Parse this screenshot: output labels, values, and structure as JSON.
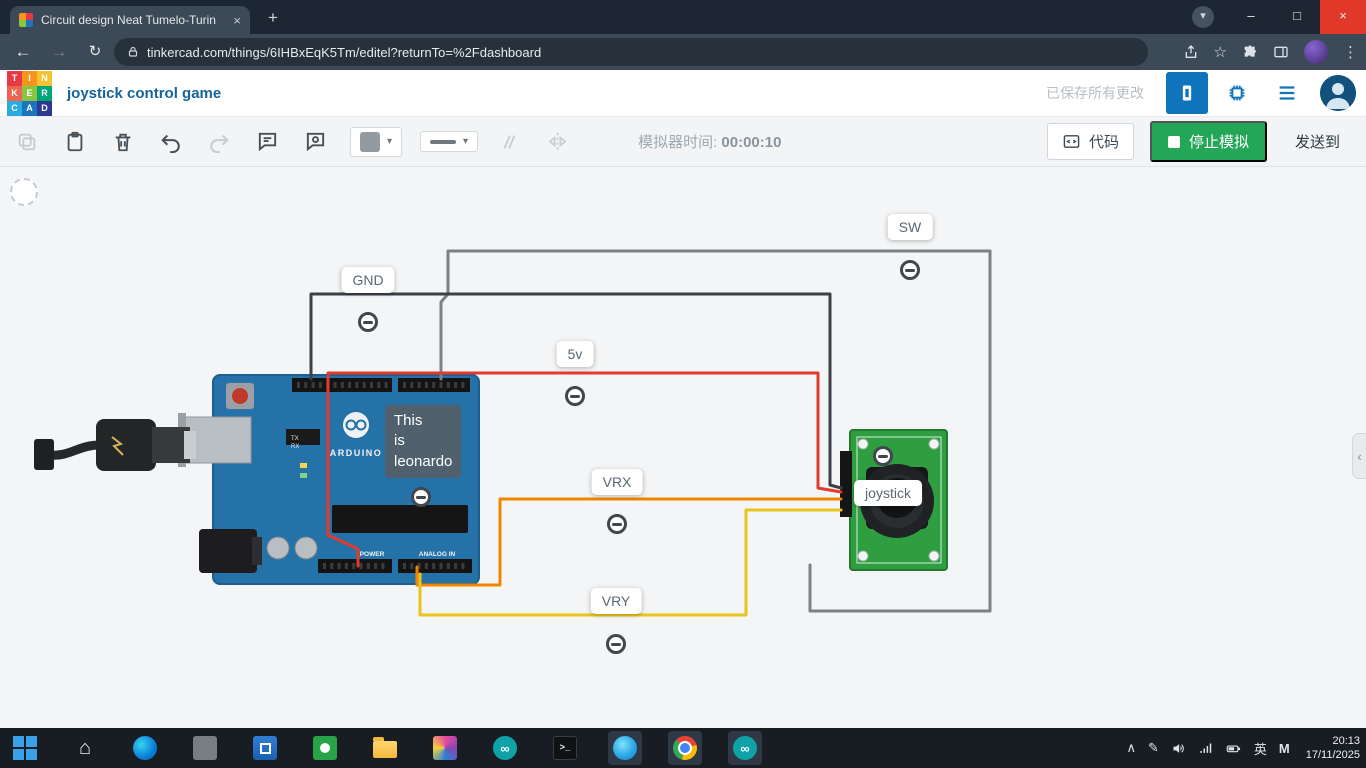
{
  "browser": {
    "tab_title": "Circuit design Neat Tumelo-Turin",
    "url": "tinkercad.com/things/6IHBxEqK5Tm/editel?returnTo=%2Fdashboard"
  },
  "header": {
    "logo": [
      [
        "T",
        "I",
        "N"
      ],
      [
        "K",
        "E",
        "R"
      ],
      [
        "C",
        "A",
        "D"
      ]
    ],
    "title": "joystick control game",
    "saved_status": "已保存所有更改"
  },
  "toolbar": {
    "sim_time_label": "模拟器时间:",
    "sim_time": "00:00:10",
    "code": "代码",
    "stop": "停止模拟",
    "send": "发送到"
  },
  "canvas": {
    "labels": {
      "gnd": "GND",
      "sw": "SW",
      "v5": "5v",
      "vrx": "VRX",
      "vry": "VRY"
    },
    "joystick": "joystick",
    "tooltip": "This\nis\nleonardo",
    "board": {
      "brand": "ARDUINO",
      "analog": "ANALOG IN",
      "power": "POWER",
      "tx": "TX",
      "rx": "RX"
    }
  },
  "taskbar": {
    "lang": "英",
    "ime": "M",
    "time": "20:13",
    "date": "17/11/2025"
  },
  "glyphs": {
    "back": "←",
    "forward": "→",
    "reload": "↻",
    "star": "☆",
    "menu": "⋮",
    "tab_search": "▾",
    "minimize": "–",
    "maximize": "□",
    "close": "×",
    "new_tab": "+",
    "tab_close": "×",
    "caret": "▾",
    "house": "⌂",
    "infinity": "∞",
    "panel_collapse": "‹",
    "tray_expand": "∧",
    "pen": "✎",
    "prompt": ">_"
  },
  "colors": {
    "accent_blue": "#1074bc",
    "stop_green": "#23a757",
    "wire_red": "#e23b2e",
    "wire_orange": "#ef8600",
    "wire_yellow": "#eac41e",
    "wire_gray": "#7b8185",
    "wire_dark": "#3c4146",
    "board_blue": "#2572a8",
    "module_green": "#2f9e41",
    "logo_tiles": [
      "#e63946",
      "#f7941d",
      "#f4c430",
      "#ef6351",
      "#8bc53f",
      "#00a676",
      "#29abe2",
      "#1c75bc",
      "#2b3990"
    ]
  }
}
